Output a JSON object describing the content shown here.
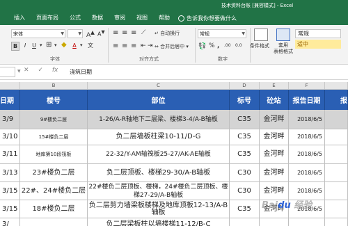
{
  "window": {
    "title": "技术资料台账 [兼容模式] - Excel"
  },
  "tabs": [
    "插入",
    "页面布局",
    "公式",
    "数据",
    "审阅",
    "视图",
    "帮助"
  ],
  "tell_me": "告诉我你想要做什么",
  "ribbon": {
    "font_name": "宋体",
    "bold": "B",
    "italic": "I",
    "underline": "U",
    "font_color_glyph": "A",
    "wen_glyph": "文",
    "font_group": "字体",
    "wrap_text": "自动换行",
    "merge_center": "合并后居中",
    "align_group": "对齐方式",
    "number_format": "常规",
    "percent": "%",
    "comma": ",",
    "dec_inc": ".00",
    "dec_dec": "0.0",
    "number_group": "数字",
    "cond_format": "条件格式",
    "table_format": "套用\n表格格式",
    "style_normal": "常规",
    "style_neutral": "适中"
  },
  "formula_bar": {
    "cancel": "✕",
    "confirm": "✓",
    "fx": "fx",
    "value": "浇筑日期"
  },
  "columns": [
    "B",
    "C",
    "D",
    "E",
    "F"
  ],
  "headers": {
    "date": "日期",
    "floor": "楼号",
    "part": "部位",
    "grade": "标号",
    "station": "砼站",
    "report_date": "报告日期",
    "report_trunc": "报"
  },
  "rows": [
    {
      "date": "3/9",
      "floor": "9#楼负二层",
      "part": "1-26/A-R轴地下二层梁、楼梯3-4/A-B轴板",
      "grade": "C35",
      "station": "金河畔",
      "report": "2018/6/5"
    },
    {
      "date": "3/10",
      "floor": "15#楼负二层",
      "part": "负二层墙板柱梁10-11/D-G",
      "grade": "C35",
      "station": "金河畔",
      "report": "2018/6/5"
    },
    {
      "date": "3/11",
      "floor": "地库第10段筏板",
      "part": "22-32/Y-AM轴筏板25-27/AK-AE轴板",
      "grade": "C35",
      "station": "金河畔",
      "report": "2018/6/5"
    },
    {
      "date": "3/13",
      "floor": "23#楼负二层",
      "part": "负二层顶板、楼梯29-30/A-B轴板",
      "grade": "C30",
      "station": "金河畔",
      "report": "2018/6/5"
    },
    {
      "date": "3/15",
      "floor": "22#、24#楼负二层",
      "part": "22#楼负二层顶板、楼梯，24#楼负二层顶板、楼梯27-29/A-B轴板",
      "grade": "C30",
      "station": "金河畔",
      "report": "2018/6/5"
    },
    {
      "date": "3/15",
      "floor": "18#楼负二层",
      "part": "负二层剪力墙梁板楼梯及地库顶板12-13/A-B轴板",
      "grade": "C35",
      "station": "金河畔",
      "report": "2018/6/5"
    },
    {
      "date": "3/",
      "floor": "",
      "part": "负二层梁板柱以墙楼梯11-12/B-C",
      "grade": "",
      "station": "",
      "report": ""
    }
  ],
  "watermark": "Baidu 经验"
}
